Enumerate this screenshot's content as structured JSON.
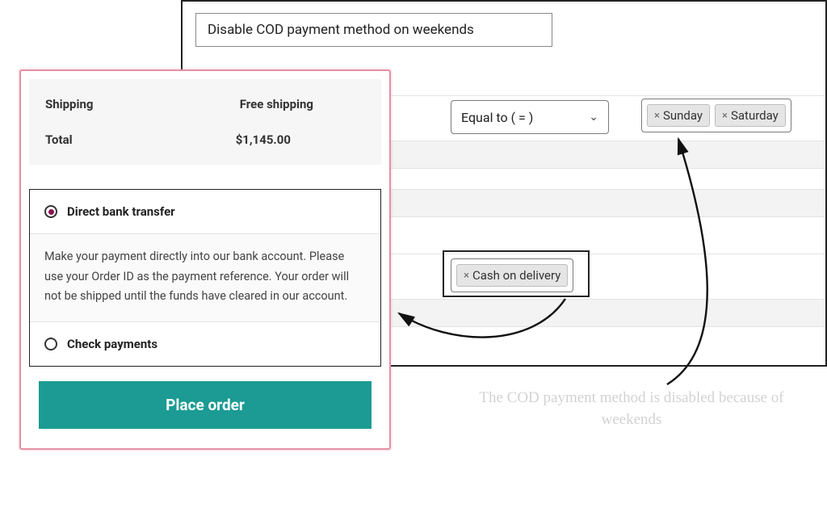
{
  "rule": {
    "title": "Disable COD payment method on weekends"
  },
  "condition": {
    "operator": "Equal to ( = )",
    "values": [
      "Sunday",
      "Saturday"
    ]
  },
  "action": {
    "values": [
      "Cash on delivery"
    ]
  },
  "checkout": {
    "shipping_label": "Shipping",
    "shipping_value": "Free shipping",
    "total_label": "Total",
    "total_value": "$1,145.00",
    "payment": {
      "bank": {
        "label": "Direct bank transfer",
        "desc": "Make your payment directly into our bank account. Please use your Order ID as the payment reference. Your order will not be shipped until the funds have cleared in our account."
      },
      "check": {
        "label": "Check payments"
      }
    },
    "button": "Place order"
  },
  "annotation": "The COD payment method is disabled because of weekends"
}
